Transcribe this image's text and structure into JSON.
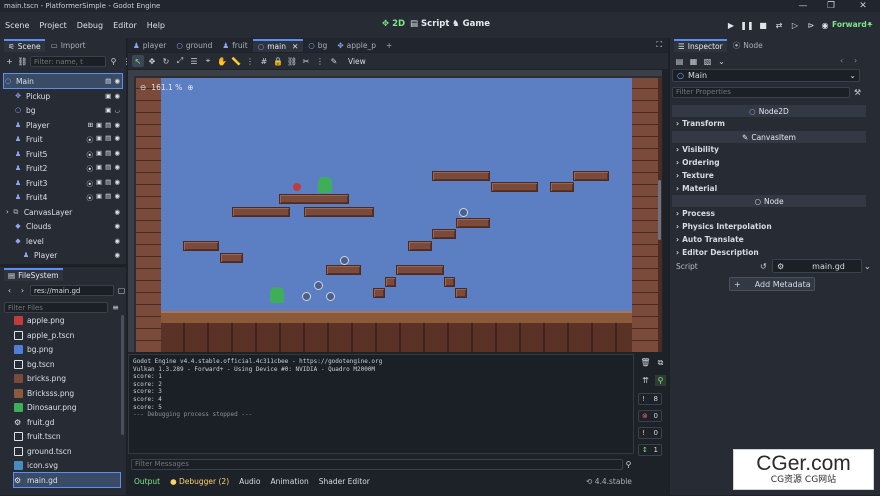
{
  "window": {
    "title": "main.tscn - PlatformerSimple - Godot Engine",
    "minimize": "—",
    "maximize": "❐",
    "close": "✕"
  },
  "menu": [
    "Scene",
    "Project",
    "Debug",
    "Editor",
    "Help"
  ],
  "workspaces": {
    "w2d": "2D",
    "script": "Script",
    "game": "Game"
  },
  "renderer": "Forward+",
  "scene_dock": {
    "tab_scene": "Scene",
    "tab_import": "Import",
    "filter_placeholder": "Filter: name, t",
    "nodes": [
      {
        "name": "Main",
        "icon": "node2d"
      },
      {
        "name": "Pickup",
        "icon": "node2d"
      },
      {
        "name": "bg",
        "icon": "node2d"
      },
      {
        "name": "Player",
        "icon": "character"
      },
      {
        "name": "Fruit",
        "icon": "character"
      },
      {
        "name": "Fruit5",
        "icon": "character"
      },
      {
        "name": "Fruit2",
        "icon": "character"
      },
      {
        "name": "Fruit3",
        "icon": "character"
      },
      {
        "name": "Fruit4",
        "icon": "character"
      },
      {
        "name": "CanvasLayer",
        "icon": "layer"
      },
      {
        "name": "Clouds",
        "icon": "node2d"
      },
      {
        "name": "level",
        "icon": "node2d"
      },
      {
        "name": "Player",
        "icon": "character"
      }
    ]
  },
  "filesystem": {
    "title": "FileSystem",
    "path": "res://main.gd",
    "filter_placeholder": "Filter Files",
    "files": [
      {
        "name": "apple.png",
        "color": "#c23b3b"
      },
      {
        "name": "apple_p.tscn",
        "color": "#e0e3e8"
      },
      {
        "name": "bg.png",
        "color": "#4f7fd6"
      },
      {
        "name": "bg.tscn",
        "color": "#e0e3e8"
      },
      {
        "name": "bricks.png",
        "color": "#7a4a3a"
      },
      {
        "name": "Bricksss.png",
        "color": "#8a5a3a"
      },
      {
        "name": "Dinosaur.png",
        "color": "#3fae5a"
      },
      {
        "name": "fruit.gd",
        "color": "#e0e3e8"
      },
      {
        "name": "fruit.tscn",
        "color": "#e0e3e8"
      },
      {
        "name": "ground.tscn",
        "color": "#e0e3e8"
      },
      {
        "name": "icon.svg",
        "color": "#478cbf"
      },
      {
        "name": "main.gd",
        "color": "#e0e3e8"
      }
    ]
  },
  "editor_tabs": [
    {
      "name": "player",
      "active": false
    },
    {
      "name": "ground",
      "active": false
    },
    {
      "name": "fruit",
      "active": false
    },
    {
      "name": "main",
      "active": true
    },
    {
      "name": "bg",
      "active": false
    },
    {
      "name": "apple_p",
      "active": false
    }
  ],
  "toolbar": {
    "view": "View"
  },
  "viewport": {
    "zoom": "161.1 %"
  },
  "output": {
    "lines": [
      "Godot Engine v4.4.stable.official.4c311cbee - https://godotengine.org",
      "Vulkan 1.3.289 - Forward+ - Using Device #0: NVIDIA - Quadro M2000M",
      "",
      "score: 1",
      "score: 2",
      "score: 3",
      "score: 4",
      "score: 5",
      "--- Debugging process stopped ---"
    ],
    "filter_placeholder": "Filter Messages",
    "counts": {
      "messages": "8",
      "errors": "0",
      "warnings": "0",
      "info": "1"
    }
  },
  "bottom_panel": {
    "tabs": [
      "Output",
      "Debugger (2)",
      "Audio",
      "Animation",
      "Shader Editor"
    ],
    "version": "4.4.stable"
  },
  "inspector": {
    "tab_inspector": "Inspector",
    "tab_node": "Node",
    "object": "Main",
    "filter_placeholder": "Filter Properties",
    "sections": {
      "node2d": "Node2D",
      "transform": "Transform",
      "canvasitem": "CanvasItem",
      "visibility": "Visibility",
      "ordering": "Ordering",
      "texture": "Texture",
      "material": "Material",
      "node": "Node",
      "process": "Process",
      "physics": "Physics Interpolation",
      "autotranslate": "Auto Translate",
      "description": "Editor Description"
    },
    "script_label": "Script",
    "script_value": "main.gd",
    "add_metadata": "Add Metadata"
  },
  "watermark": {
    "main": "CGer.com",
    "sub": "CG资源 CG网站"
  },
  "colors": {
    "accent": "#5c8ff0",
    "sky": "#5b7fc2",
    "brick": "#7a4a3a",
    "success": "#7ee787"
  }
}
